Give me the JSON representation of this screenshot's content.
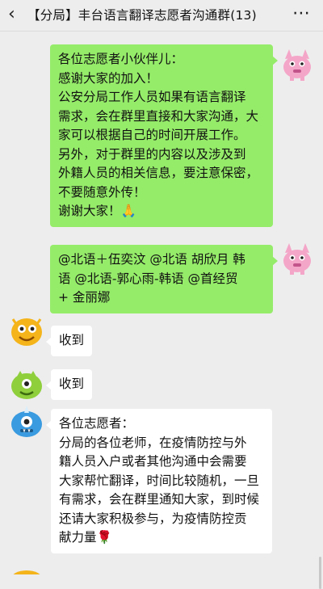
{
  "header": {
    "back_icon": "chevron-left-icon",
    "title": "【分局】丰台语言翻译志愿者沟通群(13)",
    "more_icon": "more-dots-icon"
  },
  "messages": [
    {
      "side": "right",
      "avatar": "pink-monster-avatar",
      "lines": [
        "各位志愿者小伙伴儿：",
        "感谢大家的加入！",
        "公安分局工作人员如果有语言翻译",
        "需求，会在群里直接和大家沟通，大",
        "家可以根据自己的时间开展工作。",
        "另外，对于群里的内容以及涉及到",
        "外籍人员的相关信息，要注意保密，",
        "不要随意外传！",
        "谢谢大家！🙏"
      ]
    },
    {
      "side": "right",
      "avatar": "pink-monster-avatar",
      "lines": [
        "@北语＋伍奕汶 @北语 胡欣月 韩",
        "语 @北语-郭心雨-韩语 @首经贸",
        "+ 金丽娜"
      ]
    },
    {
      "side": "left",
      "avatar": "orange-monster-avatar",
      "lines": [
        "收到"
      ]
    },
    {
      "side": "left",
      "avatar": "green-monster-avatar",
      "lines": [
        "收到"
      ]
    },
    {
      "side": "left",
      "avatar": "blue-monster-avatar",
      "lines": [
        "各位志愿者：",
        "分局的各位老师，在疫情防控与外",
        "籍人员入户或者其他沟通中会需要",
        "大家帮忙翻译，时间比较随机，一旦",
        "有需求，会在群里通知大家，到时候",
        "还请大家积极参与，为疫情防控贡",
        "献力量🌹"
      ]
    }
  ],
  "colors": {
    "own_bubble": "#95ec69",
    "other_bubble": "#ffffff",
    "background": "#ededed"
  }
}
